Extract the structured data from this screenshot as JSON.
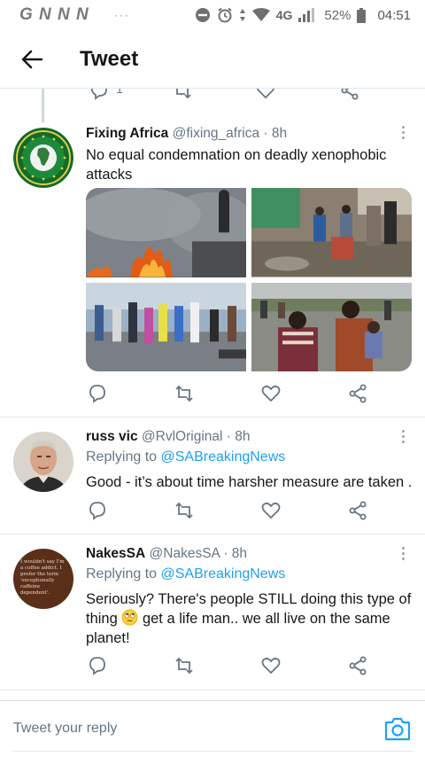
{
  "status_bar": {
    "carrier_letters": "G N N N",
    "dots": "···",
    "network": "4G",
    "battery": "52%",
    "time": "04:51"
  },
  "header": {
    "title": "Tweet"
  },
  "tweets": [
    {
      "name": "Fixing Africa",
      "handle": "@fixing_africa",
      "time": "· 8h",
      "text": "No equal condemnation on deadly xenophobic attacks"
    },
    {
      "name": "russ vic",
      "handle": "@RvlOriginal",
      "time": "· 8h",
      "replying_prefix": "Replying to",
      "replying_to": "@SABreakingNews",
      "text": "Good - it’s about time harsher measure are taken ."
    },
    {
      "name": "NakesSA",
      "handle": "@NakesSA",
      "time": "· 8h",
      "replying_prefix": "Replying to",
      "replying_to": "@SABreakingNews",
      "text_before_emoji": "Seriously? There's people STILL doing this type of thing ",
      "text_after_emoji": " get a life man.. we all live on the same planet!"
    }
  ],
  "composer": {
    "placeholder": "Tweet your reply"
  },
  "avatar_text": {
    "nakessa": "I wouldn't say I'm a coffee addict. I prefer the term 'exceptionally caffeine dependent'."
  },
  "colors": {
    "accent": "#1da1f2",
    "icon_gray": "#657786",
    "divider": "#e1e8ed"
  },
  "icons": [
    "back-arrow-icon",
    "reply-icon",
    "retweet-icon",
    "like-icon",
    "share-icon",
    "more-icon",
    "camera-icon"
  ]
}
